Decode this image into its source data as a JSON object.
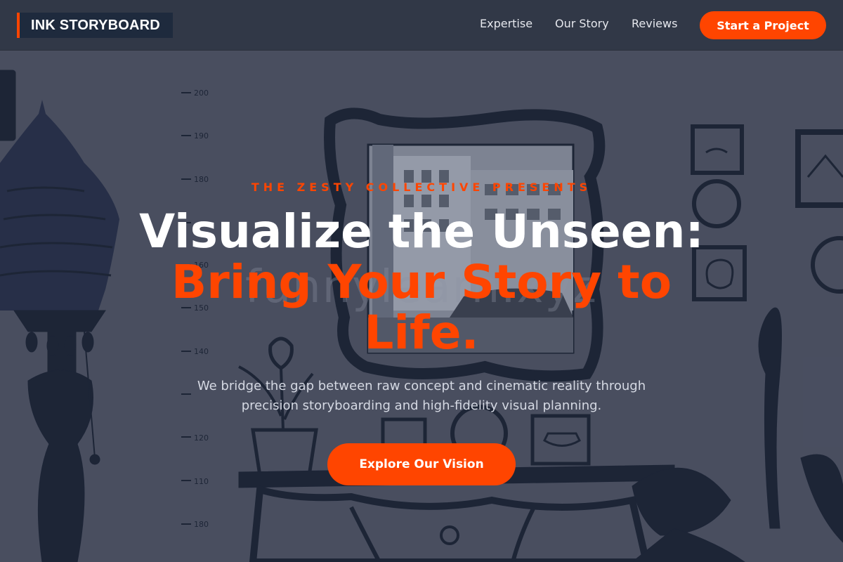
{
  "brand": {
    "name": "INK STORYBOARD"
  },
  "nav": {
    "links": [
      "Expertise",
      "Our Story",
      "Reviews"
    ],
    "cta": "Start a Project"
  },
  "hero": {
    "eyebrow": "THE ZESTY COLLECTIVE PRESENTS",
    "headline_line1": "Visualize the Unseen:",
    "headline_line2": "Bring Your Story to Life.",
    "subtext": "We bridge the gap between raw concept and cinematic reality through precision storyboarding and high-fidelity visual planning.",
    "cta": "Explore Our Vision",
    "watermark": "funnylearn.xyz",
    "background_art": "ink-mural-wall"
  },
  "colors": {
    "accent": "#ff4500",
    "header_bg": "#313847",
    "hero_bg": "#4d5263",
    "brand_bg": "#1e2a3d"
  }
}
